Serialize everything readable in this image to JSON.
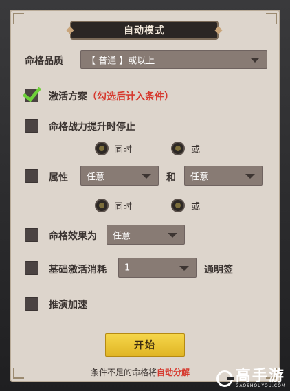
{
  "title": "自动模式",
  "quality": {
    "label": "命格品质",
    "value": "【 普通 】或以上"
  },
  "activate_plan": {
    "label": "激活方案",
    "hint": "（勾选后计入条件）",
    "checked": true
  },
  "power_stop": {
    "label": "命格战力提升时停止",
    "checked": false
  },
  "logic_row1": {
    "option_a": "同时",
    "option_b": "或"
  },
  "attribute": {
    "label": "属性",
    "select1": "任意",
    "joiner": "和",
    "select2": "任意",
    "checked": false
  },
  "logic_row2": {
    "option_a": "同时",
    "option_b": "或"
  },
  "effect": {
    "label": "命格效果为",
    "value": "任意",
    "checked": false
  },
  "cost": {
    "label": "基础激活消耗",
    "value": "1",
    "unit": "通明签",
    "checked": false
  },
  "speedup": {
    "label": "推演加速",
    "checked": false
  },
  "start_button": "开始",
  "footer": {
    "prefix": "条件不足的命格将",
    "highlight": "自动分解"
  },
  "watermark": {
    "main": "高手游",
    "sub": "GAOSHOUYOU.COM"
  },
  "colors": {
    "accent_green": "#6ed13a",
    "hint_red": "#d63a2f",
    "button_yellow": "#f5d64a"
  }
}
